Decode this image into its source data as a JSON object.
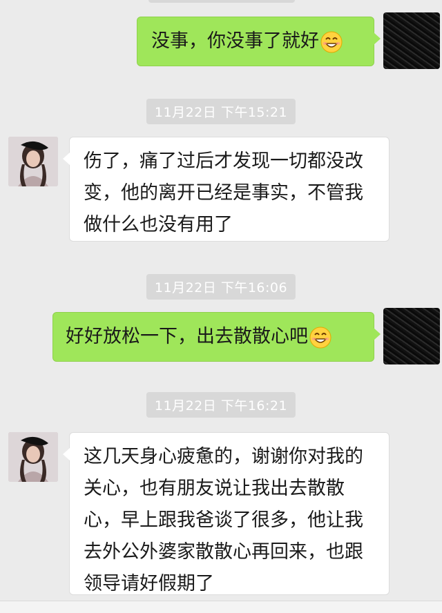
{
  "chat": {
    "messages": [
      {
        "direction": "outgoing",
        "text": "没事，你没事了就好",
        "emoji": "smiley-icon"
      },
      {
        "type": "timestamp",
        "text": "11月22日 下午15:21"
      },
      {
        "direction": "incoming",
        "lines": [
          "伤了，痛了过后才发现一切都没改",
          "变，他的离开已经是事实，不管我",
          "做什么也没有用了"
        ]
      },
      {
        "type": "timestamp",
        "text": "11月22日 下午16:06"
      },
      {
        "direction": "outgoing",
        "text": "好好放松一下，出去散散心吧",
        "emoji": "smiley-icon"
      },
      {
        "type": "timestamp",
        "text": "11月22日 下午16:21"
      },
      {
        "direction": "incoming",
        "lines": [
          "这几天身心疲惫的，谢谢你对我的",
          "关心，也有朋友说让我出去散散",
          "心，早上跟我爸谈了很多，他让我",
          "去外公外婆家散散心再回来，也跟",
          "领导请好假期了"
        ]
      }
    ]
  },
  "colors": {
    "background": "#ebebeb",
    "outgoing_bubble": "#9fe65a",
    "incoming_bubble": "#ffffff",
    "timestamp_bg": "#d8d8d8"
  }
}
